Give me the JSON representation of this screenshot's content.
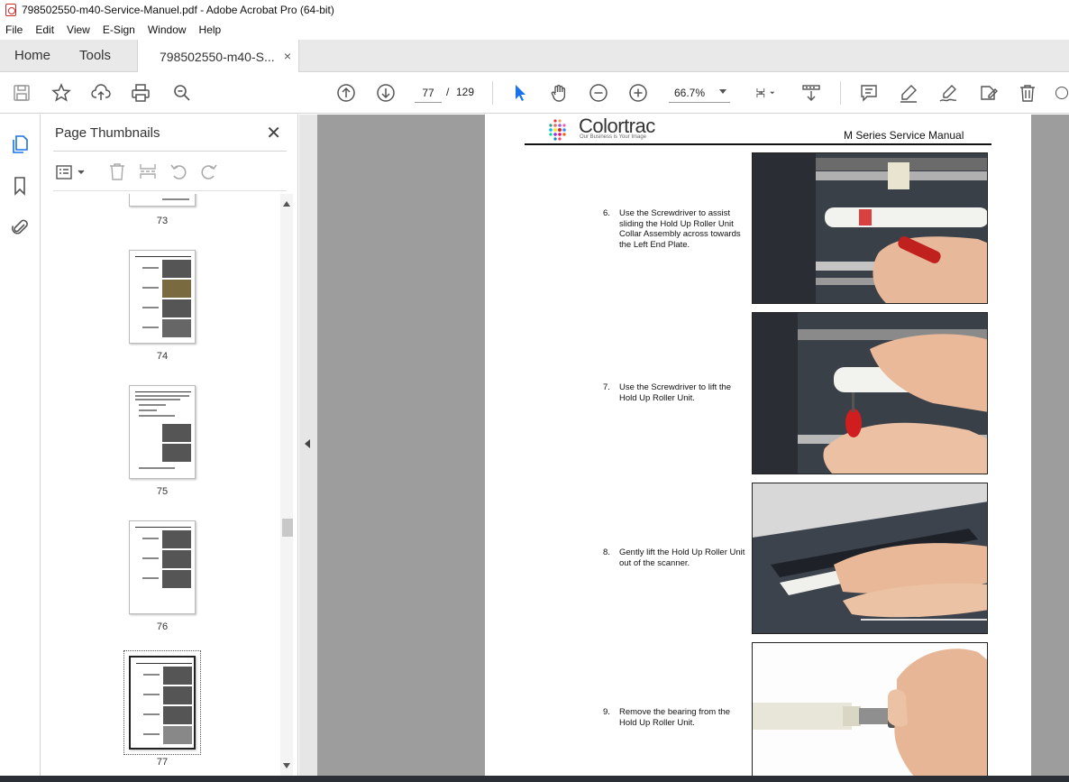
{
  "window": {
    "title": "798502550-m40-Service-Manuel.pdf - Adobe Acrobat Pro (64-bit)"
  },
  "menu": [
    "File",
    "Edit",
    "View",
    "E-Sign",
    "Window",
    "Help"
  ],
  "tabs": {
    "home": "Home",
    "tools": "Tools",
    "document": "798502550-m40-S...",
    "close": "×"
  },
  "toolbar": {
    "current_page": "77",
    "page_separator": "/",
    "total_pages": "129",
    "zoom": "66.7%"
  },
  "thumbnails_panel": {
    "title": "Page Thumbnails",
    "close": "✕",
    "pages": [
      "73",
      "74",
      "75",
      "76",
      "77"
    ],
    "selected_page": "77"
  },
  "document": {
    "brand": "Colortrac",
    "tagline": "Our Business is Your Image",
    "header_title": "M Series Service Manual",
    "steps": [
      {
        "num": "6.",
        "text": "Use the Screwdriver to assist sliding the Hold Up Roller Unit Collar Assembly across towards the Left End Plate."
      },
      {
        "num": "7.",
        "text": "Use the Screwdriver to lift the Hold Up Roller Unit."
      },
      {
        "num": "8.",
        "text": "Gently lift the Hold Up Roller Unit out of the scanner."
      },
      {
        "num": "9.",
        "text": "Remove the bearing from the Hold Up Roller Unit."
      }
    ]
  },
  "colors": {
    "accent_blue": "#1a73e8",
    "pdf_red": "#c92a2a",
    "doc_background": "#9d9d9d"
  }
}
